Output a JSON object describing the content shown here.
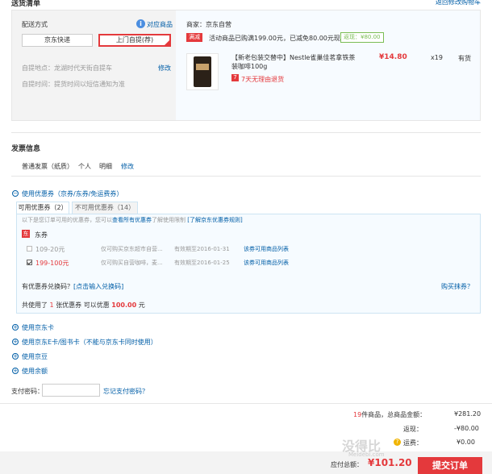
{
  "header": {
    "title": "送货清单",
    "back_link": "返回修改购物车"
  },
  "shipping": {
    "label": "配送方式",
    "help_link": "对应商品",
    "options": [
      "京东快递",
      "上门自提(荐)"
    ],
    "pickup_label": "自提地点：龙湖时代天街自提车",
    "pickup_edit": "修改",
    "pickup_time": "自提时间：提货时间以短信通知为准"
  },
  "merchant": {
    "name": "商家：京东自营",
    "promo_tag": "满减",
    "promo_text": "活动商品已购满199.00元，已减免80.00元现金",
    "discount_tag": "返现：¥80.00",
    "product_name": "【新老包装交替中】Nestle雀巢佳茗拿铁茶装咖啡100g",
    "product_price": "¥14.80",
    "product_qty": "x19",
    "product_stock": "有货",
    "return_policy": "7天无理由退货"
  },
  "invoice": {
    "title": "发票信息",
    "type": "普通发票（纸质）",
    "who": "个人",
    "detail": "明细",
    "edit": "修改"
  },
  "coupons": {
    "section_title": "使用优惠券（京券/东券/免运费券）",
    "tab_usable": "可用优惠券（2）",
    "tab_unusable": "不可用优惠券（14）",
    "notice_prefix": "以下是您订单可用的优惠券，您可以",
    "notice_link": "查看所有优惠券",
    "notice_mid": "了解使用限制",
    "notice_rule": "[了解京东优惠券规则]",
    "group_name": "东券",
    "items": [
      {
        "name": "109-20元",
        "desc": "仅可购买京东超市自营...",
        "expire": "有效期至2016-01-31",
        "link": "该券可用商品列表",
        "checked": false
      },
      {
        "name": "199-100元",
        "desc": "仅可购买自营咖啡，麦...",
        "expire": "有效期至2016-01-25",
        "link": "该券可用商品列表",
        "checked": true
      }
    ],
    "exchange_label": "有优惠券兑换码？",
    "exchange_link": "[点击输入兑换码]",
    "buy_link": "购买抹券？",
    "summary_prefix": "共使用了",
    "summary_count": "1",
    "summary_mid": "张优惠券  可以优惠",
    "summary_amount": "100.00",
    "summary_suffix": "元"
  },
  "extras": [
    "使用京东卡",
    "使用京东E卡/图书卡（不能与京东卡同时使用）",
    "使用京豆",
    "使用余额"
  ],
  "payment": {
    "label": "支付密码：",
    "forgot": "忘记支付密码？"
  },
  "totals": {
    "count": "19",
    "count_label": "件商品，总商品金额：",
    "total": "¥281.20",
    "rebate_label": "返现：",
    "rebate": "-¥80.00",
    "freight_label": "运费：",
    "freight": "¥0.00",
    "pay_label": "应付总额：",
    "pay": "¥101.20",
    "submit": "提交订单"
  },
  "watermark": {
    "main": "没得比",
    "sub": "Meidebi.com"
  }
}
